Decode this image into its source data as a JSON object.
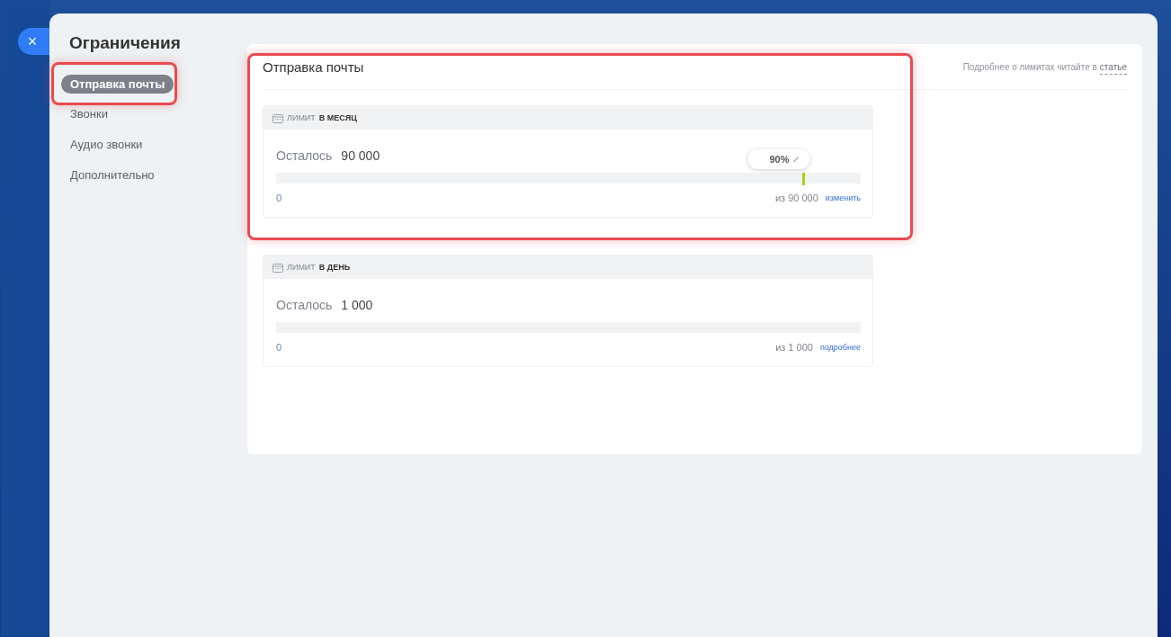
{
  "close_button": {
    "label": "×"
  },
  "title": "Ограничения",
  "sidebar": {
    "highlighted": true,
    "items": [
      {
        "label": "Отправка почты",
        "selected": true
      },
      {
        "label": "Звонки",
        "selected": false
      },
      {
        "label": "Аудио звонки",
        "selected": false
      },
      {
        "label": "Дополнительно",
        "selected": false
      }
    ]
  },
  "content": {
    "highlighted": true,
    "heading": "Отправка почты",
    "help_text": "Подробнее о лимитах читайте в",
    "help_link": "статье",
    "limits": [
      {
        "label_prefix": "ЛИМИТ",
        "label_period": "В МЕСЯЦ",
        "remaining_label": "Осталось",
        "remaining_value": "90 000",
        "min": "0",
        "total": "из 90 000",
        "action": "изменить",
        "threshold": {
          "label": "90%",
          "level": 0.9
        }
      },
      {
        "label_prefix": "ЛИМИТ",
        "label_period": "В ДЕНЬ",
        "remaining_label": "Осталось",
        "remaining_value": "1 000",
        "min": "0",
        "total": "из 1 000",
        "action": "подробнее"
      }
    ]
  }
}
